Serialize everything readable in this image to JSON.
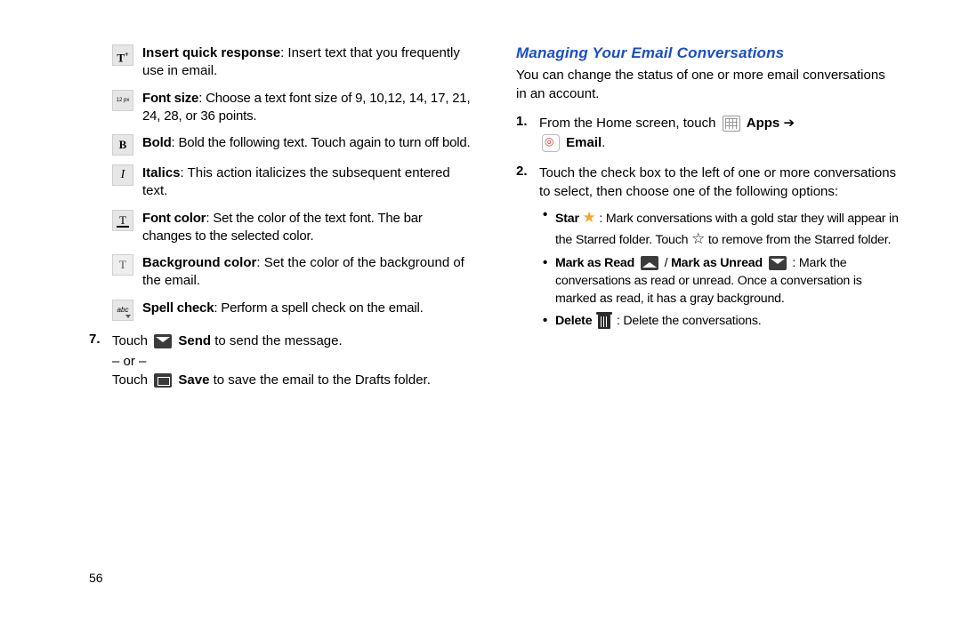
{
  "page_number": "56",
  "left": {
    "rows": [
      {
        "icon": "T⁺",
        "lead": "Insert quick response",
        "rest": ": Insert text that you frequently use in email."
      },
      {
        "icon": "12 px",
        "lead": "Font size",
        "rest": ": Choose a text font size of 9, 10,12, 14, 17, 21, 24, 28, or 36 points."
      },
      {
        "icon": "B",
        "lead": "Bold",
        "rest": ": Bold the following text. Touch again to turn off bold."
      },
      {
        "icon": "I",
        "lead": "Italics",
        "rest": ": This action italicizes the subsequent entered text."
      },
      {
        "icon": "T",
        "lead": "Font color",
        "rest": ": Set the color of the text font. The bar changes to the selected color."
      },
      {
        "icon": "T",
        "lead": "Background color",
        "rest": ": Set the color of the background of the email."
      },
      {
        "icon": "abc",
        "lead": "Spell check",
        "rest": ": Perform a spell check on the email."
      }
    ],
    "step7": {
      "num": "7.",
      "touch1_pre": "Touch ",
      "touch1_label": " Send",
      "touch1_post": " to send the message.",
      "or": "– or –",
      "touch2_pre": "Touch ",
      "touch2_label": " Save",
      "touch2_post": " to save the email to the Drafts folder."
    }
  },
  "right": {
    "heading": "Managing Your Email Conversations",
    "intro": "You can change the status of one or more email conversations in an account.",
    "step1": {
      "num": "1.",
      "pre": "From the Home screen, touch ",
      "apps": " Apps ",
      "arrow": "➔",
      "email": " Email",
      "dot": "."
    },
    "step2": {
      "num": "2.",
      "text": "Touch the check box to the left of one or more conversations to select, then choose one of the following options:"
    },
    "bullets": {
      "star": {
        "lead": "Star ",
        "mid": " : Mark conversations with a gold star they will appear in the Starred folder. Touch ",
        "post": " to remove from the Starred folder."
      },
      "mark": {
        "lead1": "Mark as Read ",
        "sep": " / ",
        "lead2": "Mark as Unread ",
        "rest": " : Mark the conversations as read or unread. Once a conversation is marked as read, it has a gray background."
      },
      "delete": {
        "lead": "Delete ",
        "rest": " : Delete the conversations."
      }
    }
  }
}
